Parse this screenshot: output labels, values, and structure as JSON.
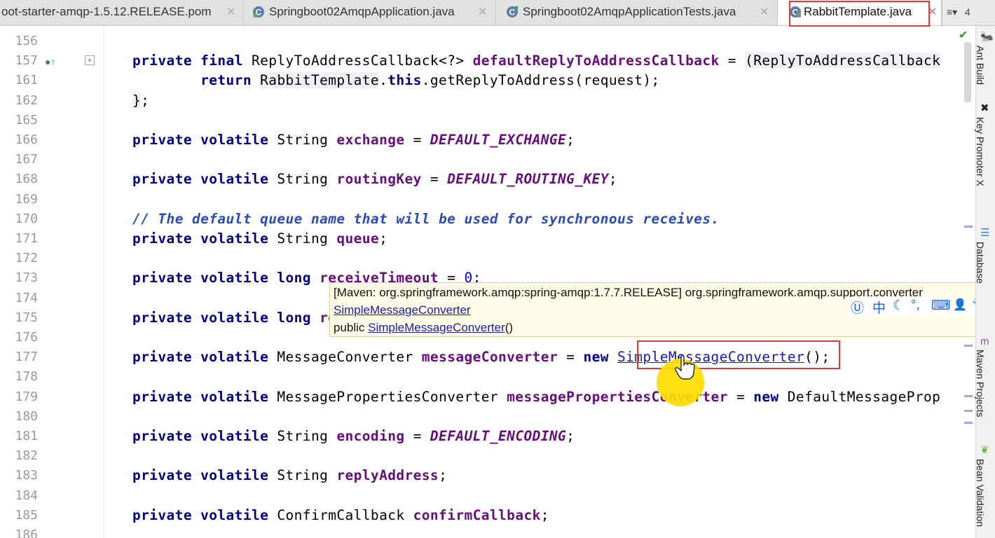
{
  "tabs": [
    {
      "label": "oot-starter-amqp-1.5.12.RELEASE.pom",
      "icon": "maven-file-icon",
      "active": false
    },
    {
      "label": "Springboot02AmqpApplication.java",
      "icon": "spring-class-icon",
      "active": false
    },
    {
      "label": "Springboot02AmqpApplicationTests.java",
      "icon": "class-icon",
      "active": false
    },
    {
      "label": "RabbitTemplate.java",
      "icon": "locked-class-icon",
      "active": true
    }
  ],
  "tab_overflow": {
    "icon": "tab-list-icon",
    "count": "4"
  },
  "lines": [
    {
      "n": "156",
      "tokens": [
        {
          "t": "",
          "c": "plain"
        }
      ]
    },
    {
      "n": "157",
      "tokens": [
        {
          "t": "private final ",
          "c": "kw"
        },
        {
          "t": "ReplyToAddressCallback<?> ",
          "c": "plain"
        },
        {
          "t": "defaultReplyToAddressCallback",
          "c": "fld"
        },
        {
          "t": " = ",
          "c": "plain"
        },
        {
          "t": "(ReplyToAddressCallback",
          "c": "fold"
        }
      ]
    },
    {
      "n": "161",
      "tokens": [
        {
          "t": "        return ",
          "c": "kw"
        },
        {
          "t": "RabbitTemplate",
          "c": "fold"
        },
        {
          "t": ".",
          "c": "plain"
        },
        {
          "t": "this",
          "c": "kw"
        },
        {
          "t": ".getReplyToAddress(request);",
          "c": "plain"
        }
      ]
    },
    {
      "n": "162",
      "tokens": [
        {
          "t": "}",
          "c": "fold"
        },
        {
          "t": ";",
          "c": "plain"
        }
      ]
    },
    {
      "n": "165",
      "tokens": []
    },
    {
      "n": "166",
      "tokens": [
        {
          "t": "private volatile ",
          "c": "kw"
        },
        {
          "t": "String ",
          "c": "plain"
        },
        {
          "t": "exchange",
          "c": "fld"
        },
        {
          "t": " = ",
          "c": "plain"
        },
        {
          "t": "DEFAULT_EXCHANGE",
          "c": "cst"
        },
        {
          "t": ";",
          "c": "plain"
        }
      ]
    },
    {
      "n": "167",
      "tokens": []
    },
    {
      "n": "168",
      "tokens": [
        {
          "t": "private volatile ",
          "c": "kw"
        },
        {
          "t": "String ",
          "c": "plain"
        },
        {
          "t": "routingKey",
          "c": "fld"
        },
        {
          "t": " = ",
          "c": "plain"
        },
        {
          "t": "DEFAULT_ROUTING_KEY",
          "c": "cst"
        },
        {
          "t": ";",
          "c": "plain"
        }
      ]
    },
    {
      "n": "169",
      "tokens": []
    },
    {
      "n": "170",
      "tokens": [
        {
          "t": "// The default queue name that will be used for synchronous receives.",
          "c": "cmt"
        }
      ]
    },
    {
      "n": "171",
      "tokens": [
        {
          "t": "private volatile ",
          "c": "kw"
        },
        {
          "t": "String ",
          "c": "plain"
        },
        {
          "t": "queue",
          "c": "fld"
        },
        {
          "t": ";",
          "c": "plain"
        }
      ]
    },
    {
      "n": "172",
      "tokens": []
    },
    {
      "n": "173",
      "tokens": [
        {
          "t": "private volatile long ",
          "c": "kw"
        },
        {
          "t": "receiveTimeout",
          "c": "fld"
        },
        {
          "t": " = ",
          "c": "plain"
        },
        {
          "t": "0",
          "c": "num"
        },
        {
          "t": ";",
          "c": "plain"
        }
      ]
    },
    {
      "n": "174",
      "tokens": []
    },
    {
      "n": "175",
      "tokens": [
        {
          "t": "private volatile long ",
          "c": "kw"
        },
        {
          "t": "replyTimeout",
          "c": "fld"
        }
      ]
    },
    {
      "n": "176",
      "tokens": []
    },
    {
      "n": "177",
      "tokens": [
        {
          "t": "private volatile ",
          "c": "kw"
        },
        {
          "t": "MessageConverter ",
          "c": "plain"
        },
        {
          "t": "messageConverter",
          "c": "fld"
        },
        {
          "t": " = ",
          "c": "plain"
        },
        {
          "t": "new ",
          "c": "kw"
        },
        {
          "t": "SimpleMessageConverter",
          "c": "lnk"
        },
        {
          "t": "();",
          "c": "plain"
        }
      ]
    },
    {
      "n": "178",
      "tokens": []
    },
    {
      "n": "179",
      "tokens": [
        {
          "t": "private volatile ",
          "c": "kw"
        },
        {
          "t": "MessagePropertiesConverter ",
          "c": "plain"
        },
        {
          "t": "messagePropertiesConverter",
          "c": "fld"
        },
        {
          "t": " = ",
          "c": "plain"
        },
        {
          "t": "new ",
          "c": "kw"
        },
        {
          "t": "DefaultMessageProp",
          "c": "plain"
        }
      ]
    },
    {
      "n": "180",
      "tokens": []
    },
    {
      "n": "181",
      "tokens": [
        {
          "t": "private volatile ",
          "c": "kw"
        },
        {
          "t": "String ",
          "c": "plain"
        },
        {
          "t": "encoding",
          "c": "fld"
        },
        {
          "t": " = ",
          "c": "plain"
        },
        {
          "t": "DEFAULT_ENCODING",
          "c": "cst"
        },
        {
          "t": ";",
          "c": "plain"
        }
      ]
    },
    {
      "n": "182",
      "tokens": []
    },
    {
      "n": "183",
      "tokens": [
        {
          "t": "private volatile ",
          "c": "kw"
        },
        {
          "t": "String ",
          "c": "plain"
        },
        {
          "t": "replyAddress",
          "c": "fld"
        },
        {
          "t": ";",
          "c": "plain"
        }
      ]
    },
    {
      "n": "184",
      "tokens": []
    },
    {
      "n": "185",
      "tokens": [
        {
          "t": "private volatile ",
          "c": "kw"
        },
        {
          "t": "ConfirmCallback ",
          "c": "plain"
        },
        {
          "t": "confirmCallback",
          "c": "fld"
        },
        {
          "t": ";",
          "c": "plain"
        }
      ]
    },
    {
      "n": "186",
      "tokens": []
    }
  ],
  "tooltip": {
    "header": "[Maven: org.springframework.amqp:spring-amqp:1.7.7.RELEASE] org.springframework.amqp.support.converter",
    "class_link": "SimpleMessageConverter",
    "ctor_prefix": "public ",
    "ctor_link": "SimpleMessageConverter",
    "ctor_suffix": "()"
  },
  "ime_toolbar": {
    "items": [
      {
        "icon": "ime-logo-icon",
        "glyph": "Ⓤ"
      },
      {
        "icon": "chinese-mode-icon",
        "glyph": "中"
      },
      {
        "icon": "half-width-icon",
        "glyph": "☾"
      },
      {
        "icon": "punctuation-icon",
        "glyph": "°,"
      },
      {
        "icon": "keyboard-icon",
        "glyph": "⌨"
      },
      {
        "icon": "user-icon",
        "glyph": "👤"
      },
      {
        "icon": "wrench-icon",
        "glyph": "🔧"
      }
    ]
  },
  "side_panels": [
    {
      "label": "Ant Build",
      "icon": "ant-icon"
    },
    {
      "label": "Key Promoter X",
      "icon": "key-promoter-icon"
    },
    {
      "label": "Database",
      "icon": "database-icon"
    },
    {
      "label": "Maven Projects",
      "icon": "maven-icon"
    },
    {
      "label": "Bean Validation",
      "icon": "bean-icon"
    }
  ],
  "colors": {
    "keyword": "#000080",
    "field": "#660e7a",
    "comment": "#2a4bb8",
    "number": "#0000ff",
    "highlight_box": "#e53935",
    "tooltip_bg": "#fffde7",
    "cursor_halo": "#ffdd00"
  }
}
